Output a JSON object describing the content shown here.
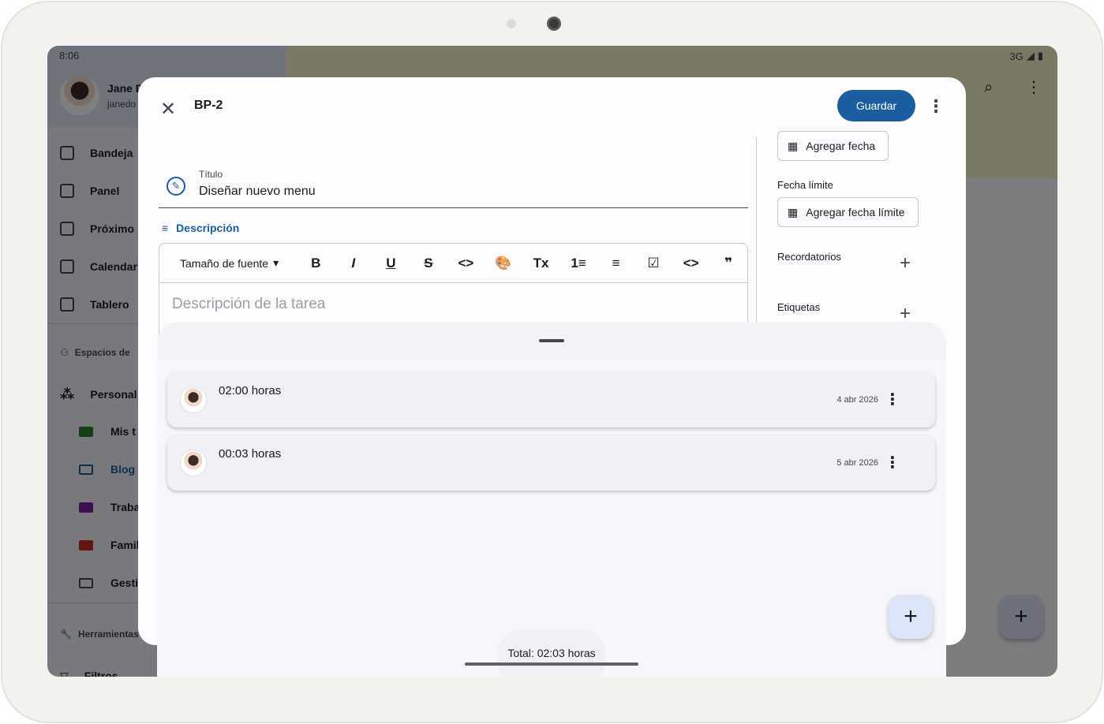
{
  "status_bar": {
    "time": "8:06",
    "network": "3G"
  },
  "drawer": {
    "user_name": "Jane D",
    "user_email": "janedo",
    "items": [
      {
        "label": "Bandeja",
        "icon": "inbox-icon"
      },
      {
        "label": "Panel",
        "icon": "dashboard-icon"
      },
      {
        "label": "Próximo",
        "icon": "calendar-upcoming-icon"
      },
      {
        "label": "Calendar",
        "icon": "calendar-icon"
      },
      {
        "label": "Tablero",
        "icon": "board-icon"
      }
    ],
    "spaces_label": "Espacios de",
    "personal_label": "Personal",
    "folders": [
      {
        "label": "Mis t",
        "color": "#2e7d32"
      },
      {
        "label": "Blog",
        "color": "#1b5e9f"
      },
      {
        "label": "Traba",
        "color": "#7b1fa2"
      },
      {
        "label": "Famil",
        "color": "#c62828"
      },
      {
        "label": "Gesti",
        "color": "#44474e"
      }
    ],
    "tools_label": "Herramientas",
    "filters_label": "Filtros"
  },
  "dialog": {
    "title": "BP-2",
    "save_label": "Guardar",
    "title_field_label": "Título",
    "title_field_value": "Diseñar nuevo menu",
    "description_label": "Descripción",
    "font_size_label": "Tamaño de fuente",
    "toolbar_buttons": [
      "B",
      "I",
      "U",
      "S",
      "<>",
      "🎨",
      "Tx",
      "1≡",
      "≡",
      "☑",
      "<>",
      "❞"
    ],
    "description_placeholder": "Descripción de la tarea",
    "add_date_label": "Agregar fecha",
    "due_date_label": "Fecha límite",
    "add_due_date_label": "Agregar fecha límite",
    "reminders_label": "Recordatorios",
    "tags_label": "Etiquetas"
  },
  "sheet": {
    "entries": [
      {
        "hours": "02:00 horas",
        "date": "4 abr 2026"
      },
      {
        "hours": "00:03 horas",
        "date": "5 abr 2026"
      }
    ],
    "total": "Total: 02:03 horas"
  },
  "colors": {
    "accent": "#1b5e9f",
    "fab": "#dde6f8"
  }
}
